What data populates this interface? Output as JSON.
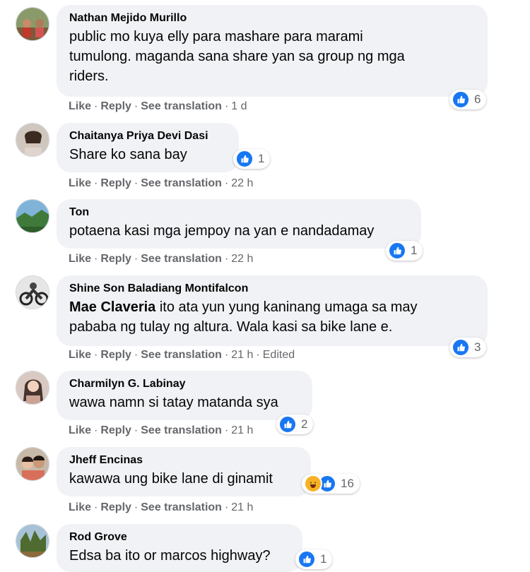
{
  "colors": {
    "like_blue": "#1877f2",
    "bubble_bg": "#f0f2f5",
    "meta_gray": "#65676b"
  },
  "actions": {
    "like": "Like",
    "reply": "Reply",
    "see_translation": "See translation"
  },
  "comments": [
    {
      "author": "Nathan Mejido Murillo",
      "lines": [
        "public mo kuya elly para mashare para marami",
        "tumulong. maganda sana share yan sa group ng mga",
        "riders."
      ],
      "time": "1 d",
      "likes": "6",
      "avatar": "avatar-group-photo"
    },
    {
      "author": "Chaitanya Priya Devi Dasi",
      "lines": [
        "Share ko sana bay"
      ],
      "time": "22 h",
      "likes": "1",
      "avatar": "avatar-portrait"
    },
    {
      "author": "Ton",
      "lines": [
        "potaena kasi mga jempoy na yan e nandadamay"
      ],
      "time": "22 h",
      "likes": "1",
      "avatar": "avatar-landscape"
    },
    {
      "author": "Shine Son Baladiang Montifalcon",
      "mention": "Mae Claveria",
      "lines": [
        " ito ata yun yung kaninang umaga sa may",
        "pababa ng tulay ng altura. Wala kasi sa bike lane e."
      ],
      "time": "21 h",
      "edited": "Edited",
      "likes": "3",
      "avatar": "avatar-motorbike"
    },
    {
      "author": "Charmilyn G. Labinay",
      "lines": [
        "wawa namn si tatay matanda sya"
      ],
      "time": "21 h",
      "likes": "2",
      "avatar": "avatar-portrait"
    },
    {
      "author": "Jheff Encinas",
      "lines": [
        "kawawa ung bike lane di ginamit"
      ],
      "time": "21 h",
      "likes": "16",
      "avatar": "avatar-couple"
    },
    {
      "author": "Rod Grove",
      "lines": [
        "Edsa ba ito or marcos highway?"
      ],
      "likes": "1",
      "avatar": "avatar-trees"
    }
  ]
}
